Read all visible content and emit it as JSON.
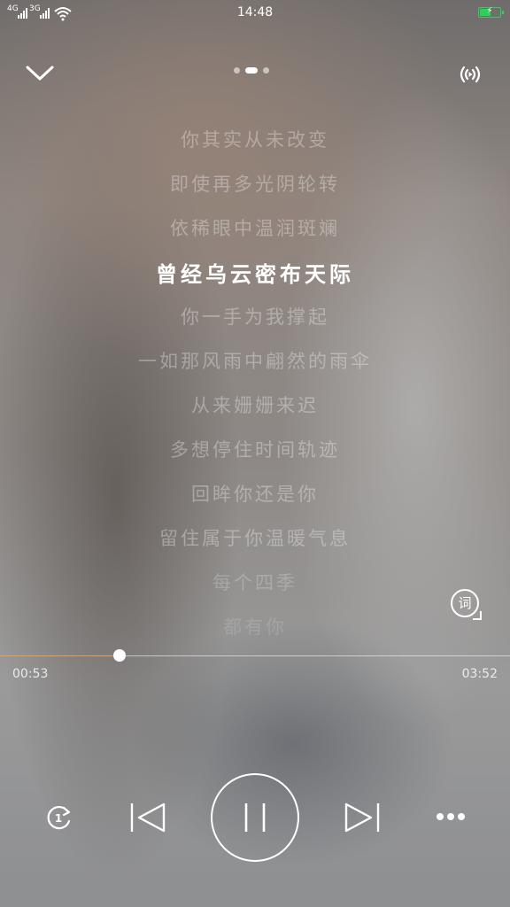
{
  "status": {
    "signal1": "4G",
    "signal2": "3G",
    "time": "14:48",
    "battery_level": 0.55,
    "battery_color": "#2ecf5a"
  },
  "header": {
    "collapse_icon": "chevron-down-icon",
    "page_count": 3,
    "active_page": 1,
    "cast_icon": "broadcast-icon"
  },
  "lyrics": {
    "current_index": 3,
    "lines": [
      "你其实从未改变",
      "即使再多光阴轮转",
      "依稀眼中温润斑斓",
      "曾经乌云密布天际",
      "你一手为我撑起",
      "一如那风雨中翩然的雨伞",
      "从来姗姗来迟",
      "多想停住时间轨迹",
      "回眸你还是你",
      "留住属于你温暖气息",
      "每个四季",
      "都有你"
    ]
  },
  "lyric_toggle": {
    "label": "词"
  },
  "playback": {
    "elapsed": "00:53",
    "duration": "03:52",
    "progress": 0.235,
    "accent": "#f39a4e"
  },
  "controls": {
    "repeat_icon": "repeat-one-icon",
    "repeat_badge": "1",
    "prev_icon": "previous-icon",
    "play_pause_icon": "pause-icon",
    "next_icon": "next-icon",
    "more_icon": "more-icon"
  }
}
